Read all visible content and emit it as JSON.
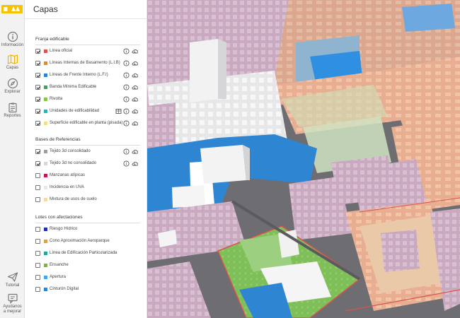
{
  "rail": {
    "items": [
      {
        "label": "Información",
        "icon": "info-icon"
      },
      {
        "label": "Capas",
        "icon": "map-layers-icon"
      },
      {
        "label": "Explorar",
        "icon": "compass-icon"
      },
      {
        "label": "Reportes",
        "icon": "clipboard-icon"
      },
      {
        "label": "Tutorial",
        "icon": "paper-plane-icon"
      },
      {
        "label": "Ayudanos a mejorar",
        "icon": "feedback-icon"
      }
    ],
    "accent": "#f5c400"
  },
  "panel": {
    "title": "Capas",
    "sections": [
      {
        "title": "Franja edificable",
        "rows": [
          {
            "label": "Línea oficial",
            "checked": true,
            "color": "#d9534f"
          },
          {
            "label": "Líneas Internas de Basamento (L.I.B)",
            "checked": true,
            "color": "#e08a2e"
          },
          {
            "label": "Líneas de Frente Interno (L.F.I)",
            "checked": true,
            "color": "#2f7fd6"
          },
          {
            "label": "Banda Mínima Edificable",
            "checked": true,
            "color": "#3aa35c"
          },
          {
            "label": "Rivolta",
            "checked": true,
            "color": "#8bc34a"
          },
          {
            "label": "Unidades de edificabilidad",
            "checked": true,
            "color": "#26b3c4"
          },
          {
            "label": "Superficie edificable en planta (pisada)",
            "checked": true,
            "color": "#f1e08a"
          }
        ]
      },
      {
        "title": "Bases de Referencias",
        "rows": [
          {
            "label": "Tejido 3d consolidado",
            "checked": true,
            "color": "#9e9e9e"
          },
          {
            "label": "Tejido 3d no consolidado",
            "checked": true,
            "color": "#d7d7d7"
          },
          {
            "label": "Manzanas atípicas",
            "checked": false,
            "color": "#c2185b"
          },
          {
            "label": "Incidencia en UVA",
            "checked": false,
            "color": "#e8e8e8"
          },
          {
            "label": "Mixtura de usos de suelo",
            "checked": false,
            "color": "#f5d9a8"
          }
        ]
      },
      {
        "title": "Lotes con afectaciones",
        "rows": [
          {
            "label": "Riesgo Hídrico",
            "checked": false,
            "color": "#1f2fb5"
          },
          {
            "label": "Cono Aproximación Aeroparque",
            "checked": false,
            "color": "#e0a33b"
          },
          {
            "label": "Línea de Edificación Particularizada",
            "checked": false,
            "color": "#26a69a"
          },
          {
            "label": "Ensanche",
            "checked": false,
            "color": "#7cb342"
          },
          {
            "label": "Apertura",
            "checked": false,
            "color": "#42a5f5"
          },
          {
            "label": "Cinturón Digital",
            "checked": false,
            "color": "#1e88e5"
          }
        ]
      }
    ]
  }
}
